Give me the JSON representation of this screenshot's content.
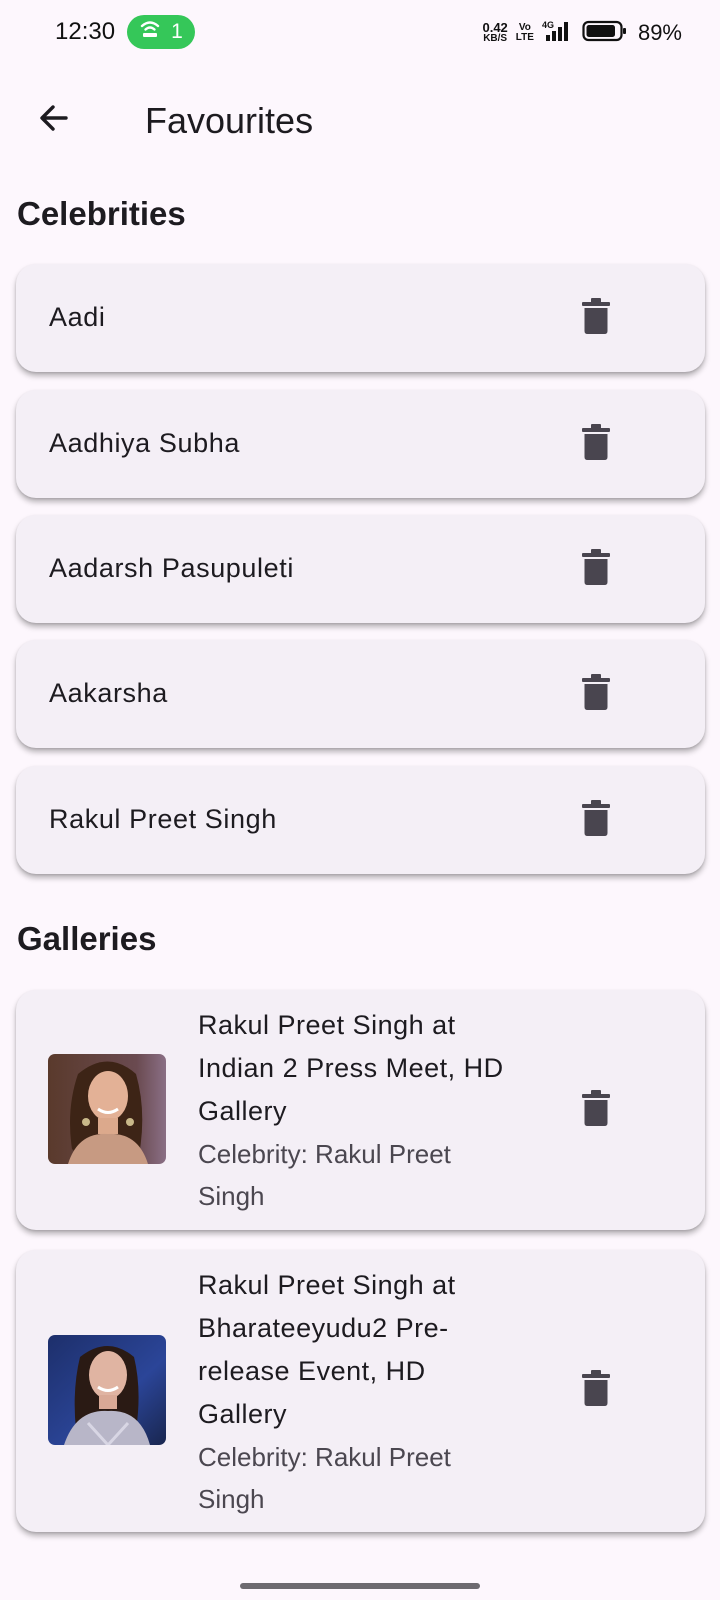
{
  "status_bar": {
    "time": "12:30",
    "hotspot_count": "1",
    "speed_value": "0.42",
    "speed_unit": "KB/S",
    "volte_top": "Vo",
    "volte_bottom": "LTE",
    "network": "4G",
    "battery_percent": "89%",
    "battery_level": 0.89,
    "hotspot_color": "#35c759"
  },
  "app_bar": {
    "back_icon": "arrow-left-icon",
    "title": "Favourites"
  },
  "celebrities": {
    "heading": "Celebrities",
    "items": [
      {
        "name": "Aadi"
      },
      {
        "name": "Aadhiya Subha"
      },
      {
        "name": "Aadarsh Pasupuleti"
      },
      {
        "name": "Aakarsha"
      },
      {
        "name": "Rakul Preet Singh"
      }
    ]
  },
  "galleries": {
    "heading": "Galleries",
    "items": [
      {
        "title": "Rakul Preet Singh at Indian 2 Press Meet, HD Gallery",
        "subtitle": "Celebrity: Rakul Preet Singh"
      },
      {
        "title": "Rakul Preet Singh at Bharateeyudu2 Pre-release Event, HD Gallery",
        "subtitle": "Celebrity: Rakul Preet Singh"
      }
    ]
  },
  "icons": {
    "delete": "trash-icon"
  }
}
